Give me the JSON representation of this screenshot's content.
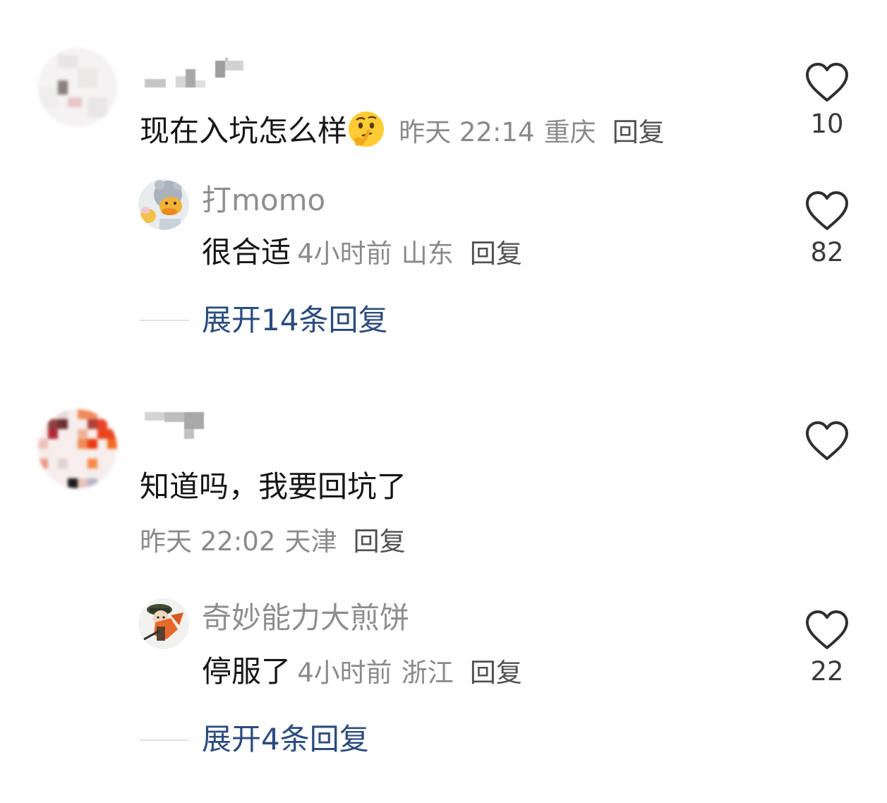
{
  "comments": [
    {
      "text": "现在入坑怎么样",
      "emoji": "thinking-face",
      "time": "昨天 22:14",
      "location": "重庆",
      "reply_label": "回复",
      "likes": "10",
      "replies": [
        {
          "username": "打momo",
          "text": "很合适",
          "time": "4小时前",
          "location": "山东",
          "reply_label": "回复",
          "likes": "82"
        }
      ],
      "expand_label": "展开14条回复"
    },
    {
      "text": "知道吗，我要回坑了",
      "time": "昨天 22:02",
      "location": "天津",
      "reply_label": "回复",
      "replies": [
        {
          "username": "奇妙能力大煎饼",
          "text": "停服了",
          "time": "4小时前",
          "location": "浙江",
          "reply_label": "回复",
          "likes": "22"
        }
      ],
      "expand_label": "展开4条回复"
    }
  ],
  "colors": {
    "expand_link": "#2b4c7e",
    "meta": "#8a8a8a",
    "text": "#161616"
  }
}
